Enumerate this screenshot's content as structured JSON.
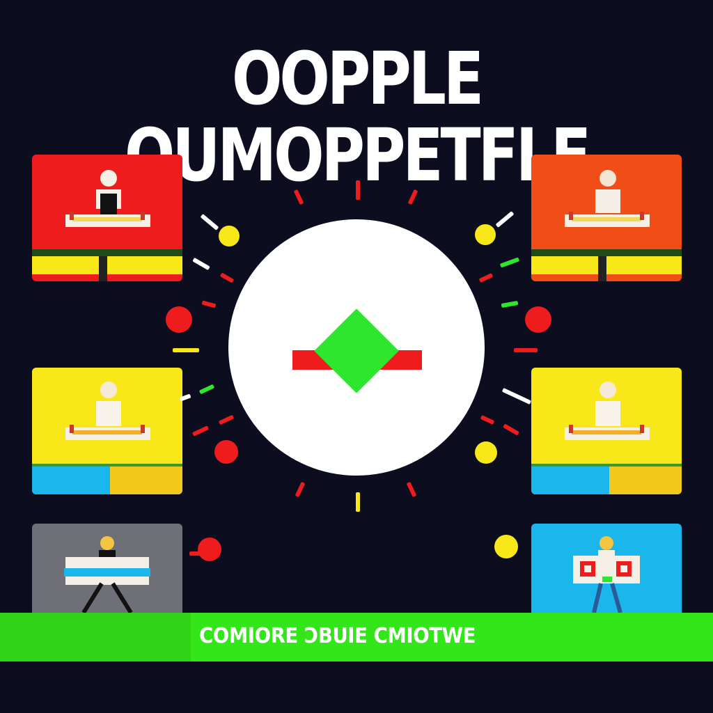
{
  "title": "OOPPLE OUMOPPETFLE",
  "footer": {
    "text": "COMIORE ƆBUIE CMIOTWE"
  },
  "colors": {
    "background": "#0d0d20",
    "red": "#ee1c1c",
    "orange": "#f04e16",
    "yellow": "#f8e81a",
    "cyan": "#1ab6ec",
    "gray": "#6f6f78",
    "green": "#2ee62e"
  },
  "cards": [
    {
      "name": "card-top-left",
      "color": "red",
      "icon": "desk-person-icon"
    },
    {
      "name": "card-top-right",
      "color": "orange",
      "icon": "desk-person-icon"
    },
    {
      "name": "card-middle-left",
      "color": "yellow",
      "icon": "desk-person-icon"
    },
    {
      "name": "card-middle-right",
      "color": "yellow",
      "icon": "desk-person-icon"
    },
    {
      "name": "card-bottom-left",
      "color": "gray",
      "icon": "person-carrying-sign-icon"
    },
    {
      "name": "card-bottom-right",
      "color": "cyan",
      "icon": "person-carrying-sign-icon"
    }
  ],
  "hub": {
    "icon": "green-diamond-icon"
  }
}
